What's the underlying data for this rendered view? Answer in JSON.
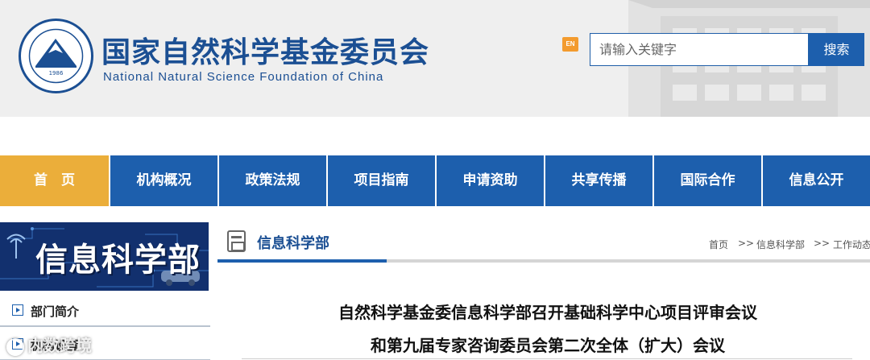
{
  "header": {
    "logo_year": "1986",
    "title_cn": "国家自然科学基金委员会",
    "title_en": "National Natural Science Foundation of China",
    "en_button": "EN",
    "search_placeholder": "请输入关键字",
    "search_button": "搜索"
  },
  "nav": {
    "items": [
      "首　页",
      "机构概况",
      "政策法规",
      "项目指南",
      "申请资助",
      "共享传播",
      "国际合作",
      "信息公开"
    ],
    "active_index": 0
  },
  "sidebar": {
    "banner_text": "信息科学部",
    "items": [
      {
        "label": "部门简介"
      },
      {
        "label": "机构设置"
      }
    ]
  },
  "section": {
    "title": "信息科学部",
    "breadcrumb": [
      "首页",
      "信息科学部",
      "工作动态"
    ],
    "breadcrumb_sep": ">>"
  },
  "article": {
    "title_line1": "自然科学基金委信息科学部召开基础科学中心项目评审会议",
    "title_line2": "和第九届专家咨询委员会第二次全体（扩大）会议"
  },
  "watermark": "内数跨境",
  "colors": {
    "brand_blue": "#1d5fad",
    "nav_active": "#ebae3a",
    "title_blue": "#1b4f93",
    "en_badge": "#f39b2e"
  }
}
